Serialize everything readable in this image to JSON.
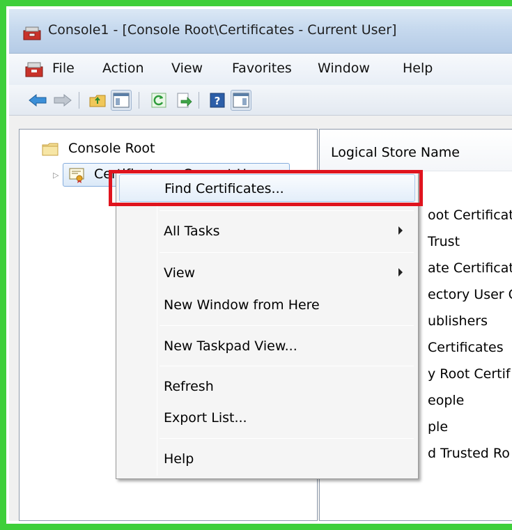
{
  "window": {
    "title": "Console1 - [Console Root\\Certificates - Current User]"
  },
  "menubar": {
    "items": [
      "File",
      "Action",
      "View",
      "Favorites",
      "Window",
      "Help"
    ]
  },
  "toolbar": {
    "buttons": [
      "back-icon",
      "forward-icon",
      "up-folder-icon",
      "show-hide-tree-icon",
      "refresh-icon",
      "export-list-icon",
      "help-icon",
      "action-pane-icon"
    ]
  },
  "tree": {
    "root_label": "Console Root",
    "child_label": "Certificates - Current User"
  },
  "list": {
    "column_header": "Logical Store Name",
    "items": [
      "oot Certificat",
      "Trust",
      "ate Certificat",
      "ectory User C",
      "ublishers",
      "Certificates",
      "y Root Certif",
      "eople",
      "ple",
      "d Trusted Ro"
    ]
  },
  "context_menu": {
    "items": [
      {
        "label": "Find Certificates...",
        "submenu": false
      },
      {
        "label": "All Tasks",
        "submenu": true
      },
      {
        "label": "View",
        "submenu": true
      },
      {
        "label": "New Window from Here",
        "submenu": false
      },
      {
        "label": "New Taskpad View...",
        "submenu": false
      },
      {
        "label": "Refresh",
        "submenu": false
      },
      {
        "label": "Export List...",
        "submenu": false
      },
      {
        "label": "Help",
        "submenu": false
      }
    ]
  },
  "colors": {
    "frame_border": "#3ecf3a",
    "highlight": "#e0141e",
    "selection": "#dbe9f8"
  }
}
